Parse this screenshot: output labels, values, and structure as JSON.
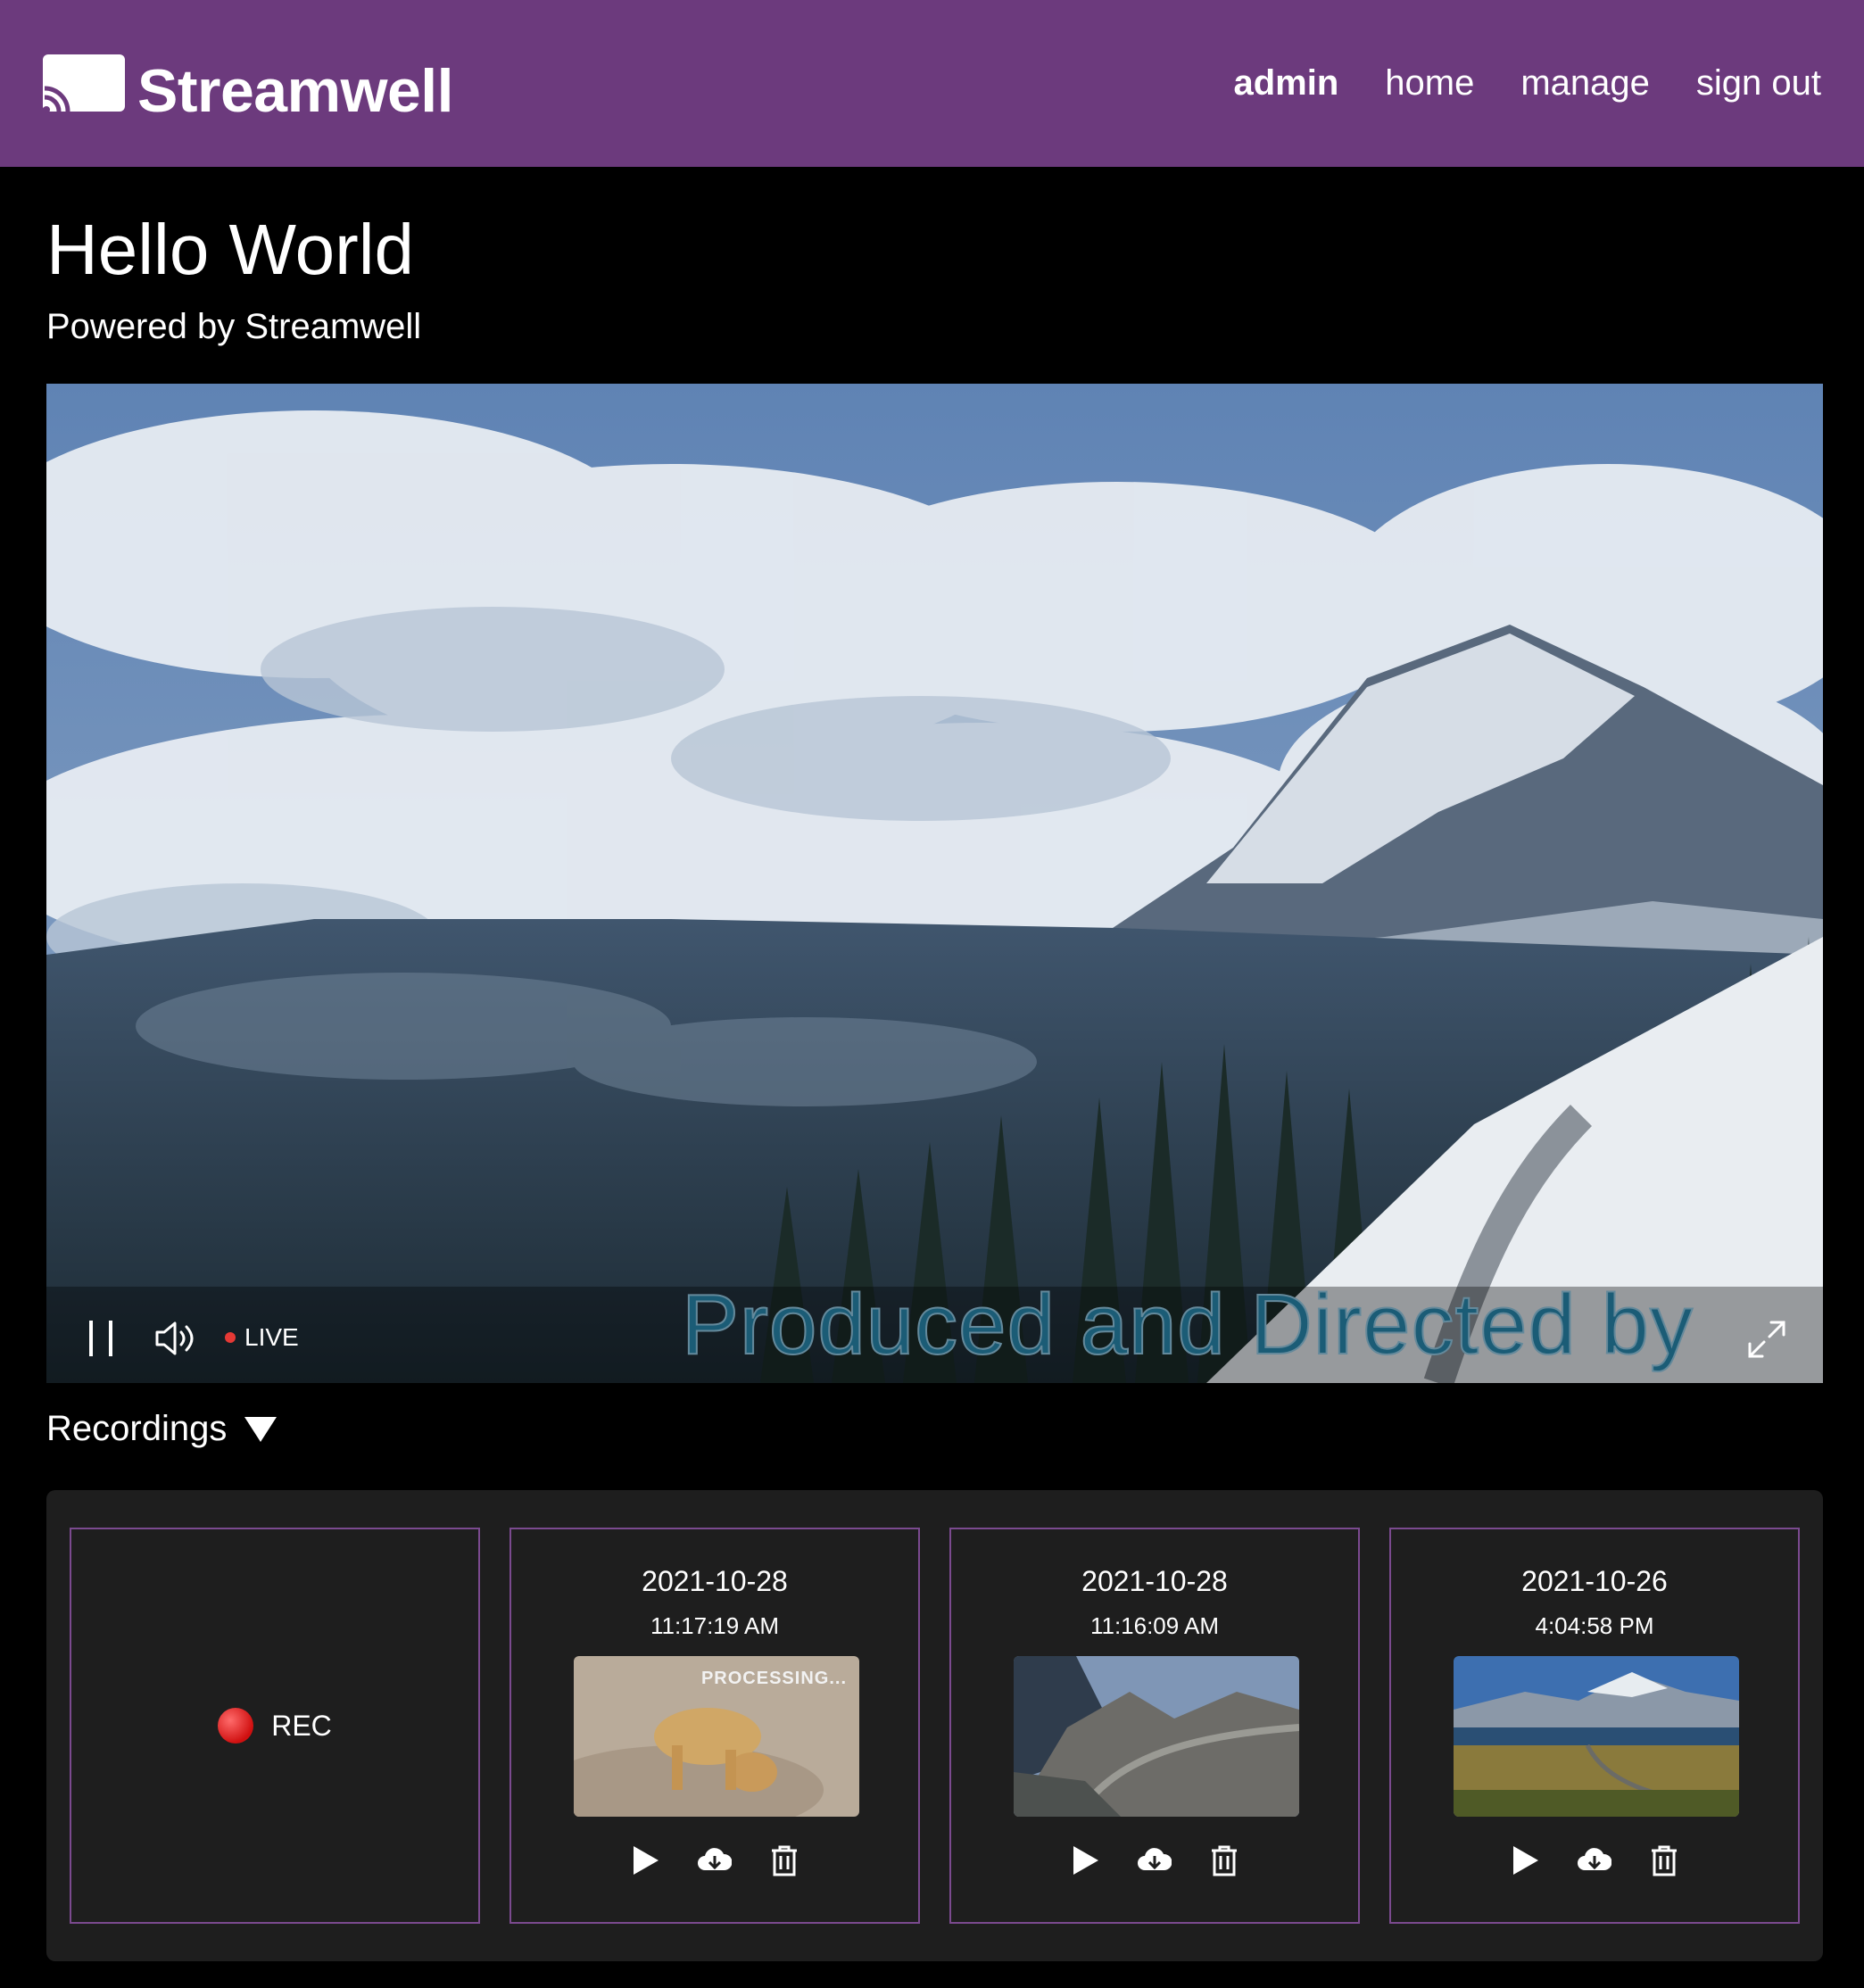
{
  "header": {
    "brand": "Streamwell",
    "nav": [
      {
        "label": "admin",
        "active": true
      },
      {
        "label": "home",
        "active": false
      },
      {
        "label": "manage",
        "active": false
      },
      {
        "label": "sign out",
        "active": false
      }
    ],
    "color": "#6c3a7d"
  },
  "page": {
    "title": "Hello World",
    "subtitle": "Powered by Streamwell"
  },
  "player": {
    "live_label": "LIVE",
    "caption": "Produced and Directed by",
    "icons": [
      "pause-icon",
      "volume-icon",
      "live-dot-icon",
      "fullscreen-icon"
    ]
  },
  "recordings": {
    "title": "Recordings",
    "toggle_icon": "triangle-down-icon",
    "rec_label": "REC",
    "items": [
      {
        "date": "2021-10-28",
        "time": "11:17:19 AM",
        "status": "PROCESSING..."
      },
      {
        "date": "2021-10-28",
        "time": "11:16:09 AM",
        "status": ""
      },
      {
        "date": "2021-10-26",
        "time": "4:04:58 PM",
        "status": ""
      }
    ],
    "action_icons": [
      "play-icon",
      "download-icon",
      "trash-icon"
    ],
    "border_color": "#7b4a8f"
  }
}
